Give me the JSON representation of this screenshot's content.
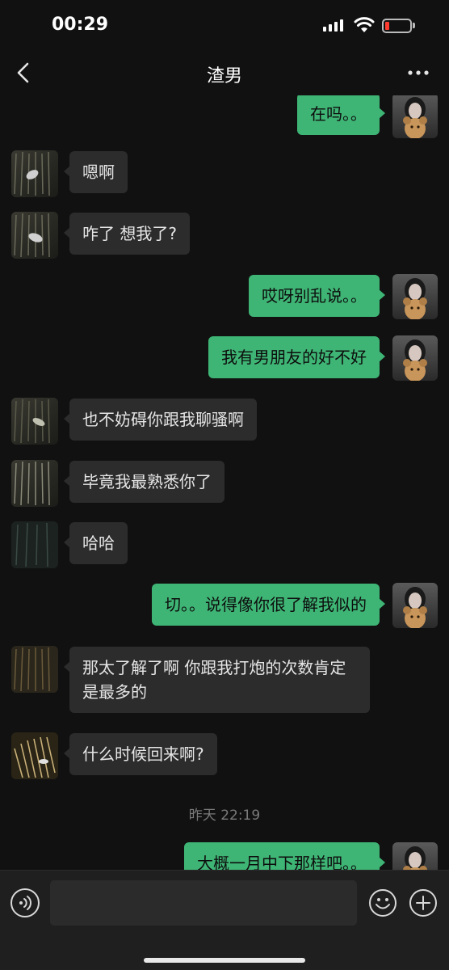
{
  "status_bar": {
    "time": "00:29"
  },
  "nav": {
    "title": "渣男",
    "back_icon": "chevron-left-icon",
    "more_icon": "more-dots-icon"
  },
  "messages": [
    {
      "side": "right",
      "text": "在吗。。"
    },
    {
      "side": "left",
      "text": "嗯啊"
    },
    {
      "side": "left",
      "text": "咋了 想我了?"
    },
    {
      "side": "right",
      "text": "哎呀别乱说。。"
    },
    {
      "side": "right",
      "text": "我有男朋友的好不好"
    },
    {
      "side": "left",
      "text": "也不妨碍你跟我聊骚啊"
    },
    {
      "side": "left",
      "text": "毕竟我最熟悉你了"
    },
    {
      "side": "left",
      "text": "哈哈"
    },
    {
      "side": "right",
      "text": "切。。说得像你很了解我似的"
    },
    {
      "side": "left",
      "text": "那太了解了啊 你跟我打炮的次数肯定是最多的"
    },
    {
      "side": "left",
      "text": "什么时候回来啊?"
    },
    {
      "side": "right",
      "text": "大概一月中下那样吧。。"
    }
  ],
  "timestamp": "昨天 22:19",
  "colors": {
    "background": "#111111",
    "bubble_sent": "#3eb575",
    "bubble_received": "#2c2c2c",
    "battery_low": "#ff3b30"
  },
  "input_bar": {
    "voice_icon": "voice-icon",
    "emoji_icon": "emoji-icon",
    "plus_icon": "plus-icon"
  }
}
